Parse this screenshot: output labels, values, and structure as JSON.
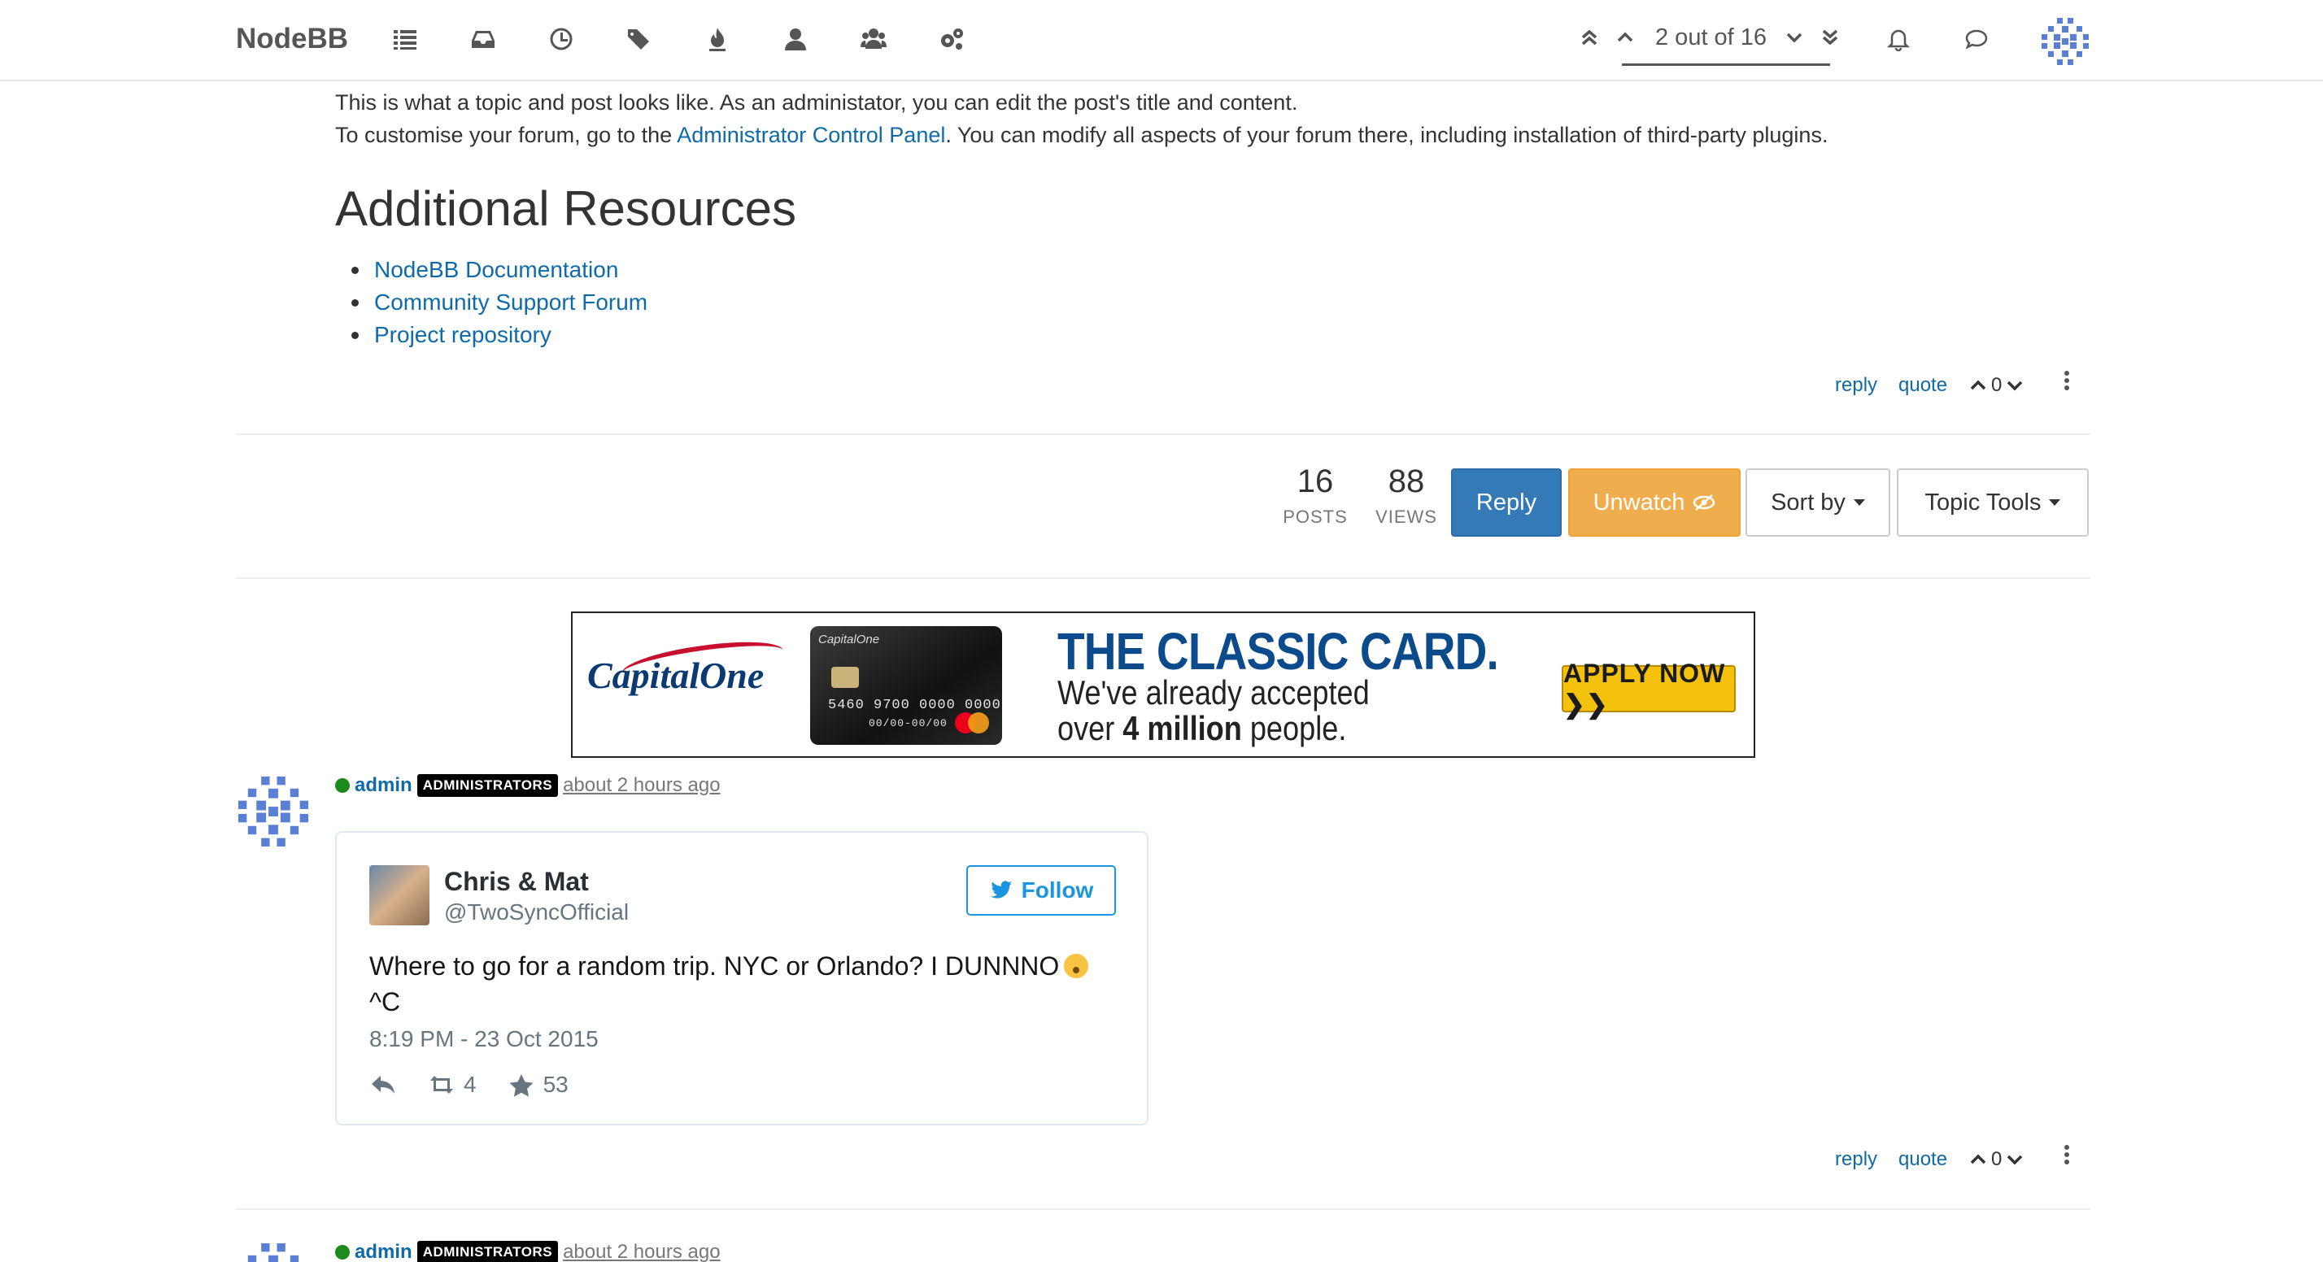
{
  "nav": {
    "brand": "NodeBB",
    "pager_text": "2 out of 16"
  },
  "post1": {
    "line1": "This is what a topic and post looks like. As an administator, you can edit the post's title and content.",
    "line2_prefix": "To customise your forum, go to the ",
    "line2_link": "Administrator Control Panel",
    "line2_suffix": ". You can modify all aspects of your forum there, including installation of third-party plugins.",
    "heading": "Additional Resources",
    "resources": [
      "NodeBB Documentation",
      "Community Support Forum",
      "Project repository"
    ],
    "tools": {
      "reply": "reply",
      "quote": "quote",
      "votes": "0"
    }
  },
  "topic_stats": {
    "posts_count": "16",
    "posts_label": "POSTS",
    "views_count": "88",
    "views_label": "VIEWS"
  },
  "topic_buttons": {
    "reply": "Reply",
    "unwatch": "Unwatch",
    "sort_by": "Sort by",
    "topic_tools": "Topic Tools"
  },
  "ad": {
    "brand": "CapitalOne",
    "card_brand": "CapitalOne",
    "card_number": "5460 9700 0000 0000",
    "card_exp": "00/00-00/00",
    "headline": "THE CLASSIC CARD.",
    "line1": "We've already accepted",
    "line2_prefix": "over ",
    "line2_bold": "4 million",
    "line2_suffix": " people.",
    "cta": "APPLY NOW ❯❯"
  },
  "post2": {
    "author": "admin",
    "group": "ADMINISTRATORS",
    "time": "about 2 hours ago",
    "tweet": {
      "name": "Chris & Mat",
      "handle": "@TwoSyncOfficial",
      "follow": "Follow",
      "text_line1": "Where to go for a random trip. NYC or Orlando? I DUNNNO",
      "text_line2": "^C",
      "date": "8:19 PM - 23 Oct 2015",
      "retweets": "4",
      "likes": "53"
    },
    "tools": {
      "reply": "reply",
      "quote": "quote",
      "votes": "0"
    }
  },
  "post3": {
    "author": "admin",
    "group": "ADMINISTRATORS",
    "time": "about 2 hours ago"
  },
  "colors": {
    "link": "#0f6aa8",
    "primary": "#337ab7",
    "warning": "#f0ad4e",
    "online": "#1d8a1d"
  },
  "icons": [
    "list-icon",
    "inbox-icon",
    "clock-icon",
    "tags-icon",
    "fire-icon",
    "user-icon",
    "users-icon",
    "cogs-icon",
    "bell-icon",
    "chat-icon"
  ]
}
